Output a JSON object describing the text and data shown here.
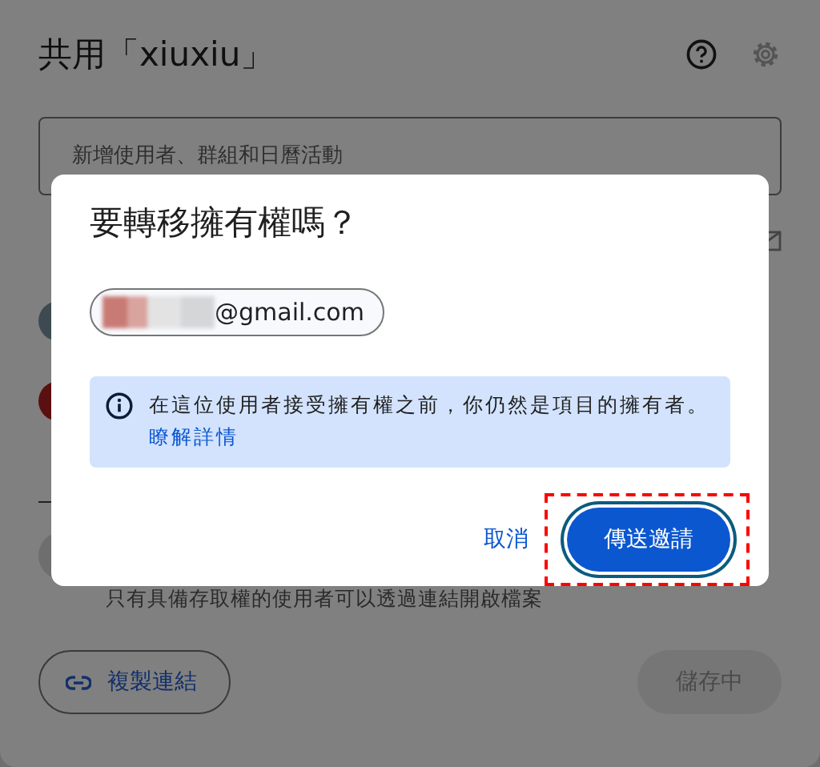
{
  "share_dialog": {
    "title": "共用「xiuxiu」",
    "add_field": {
      "placeholder": "新增使用者、群組和日曆活動"
    },
    "access_note": "只有具備存取權的使用者可以透過連結開啟檔案",
    "copy_link_button": "複製連結",
    "save_button": {
      "label": "儲存中",
      "disabled": true
    }
  },
  "transfer_dialog": {
    "title": "要轉移擁有權嗎？",
    "recipient": "@gmail.com",
    "notice": "在這位使用者接受擁有權之前，你仍然是項目的擁有者。",
    "learn_more_link": "瞭解詳情",
    "buttons": [
      {
        "label": "取消",
        "kind": "text",
        "focused": false
      },
      {
        "label": "傳送邀請",
        "kind": "filled",
        "focused": true
      }
    ]
  }
}
